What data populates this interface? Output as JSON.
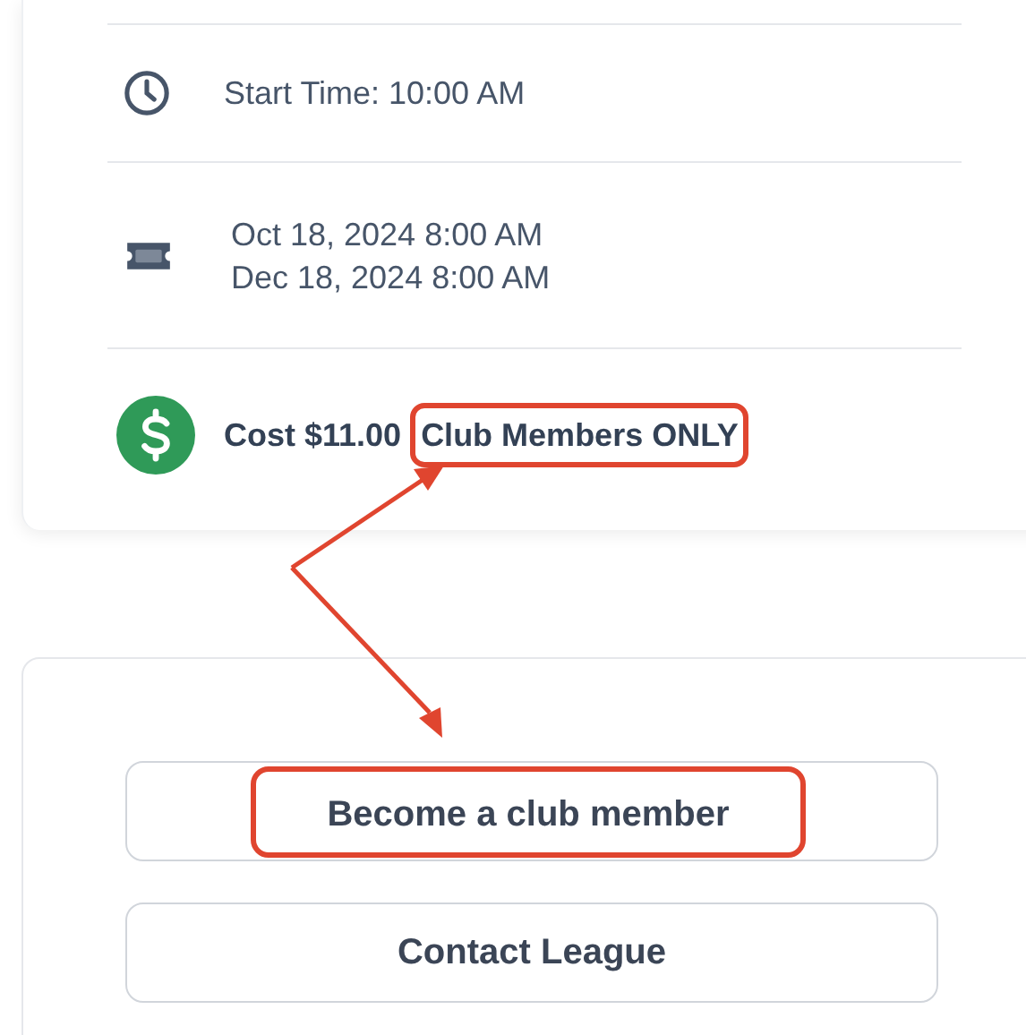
{
  "event_details": [
    {
      "kind": "time",
      "lines": [
        "Start Time: 10:00 AM"
      ]
    },
    {
      "kind": "dates",
      "lines": [
        "Oct 18, 2024 8:00 AM",
        "Dec 18, 2024 8:00 AM"
      ]
    },
    {
      "kind": "cost",
      "lines": [
        "Cost $11.00"
      ],
      "note": "Club Members ONLY",
      "highlighted": true
    }
  ],
  "actions": [
    {
      "label": "Become a club member",
      "highlighted": true
    },
    {
      "label": "Contact League",
      "highlighted": false
    }
  ]
}
